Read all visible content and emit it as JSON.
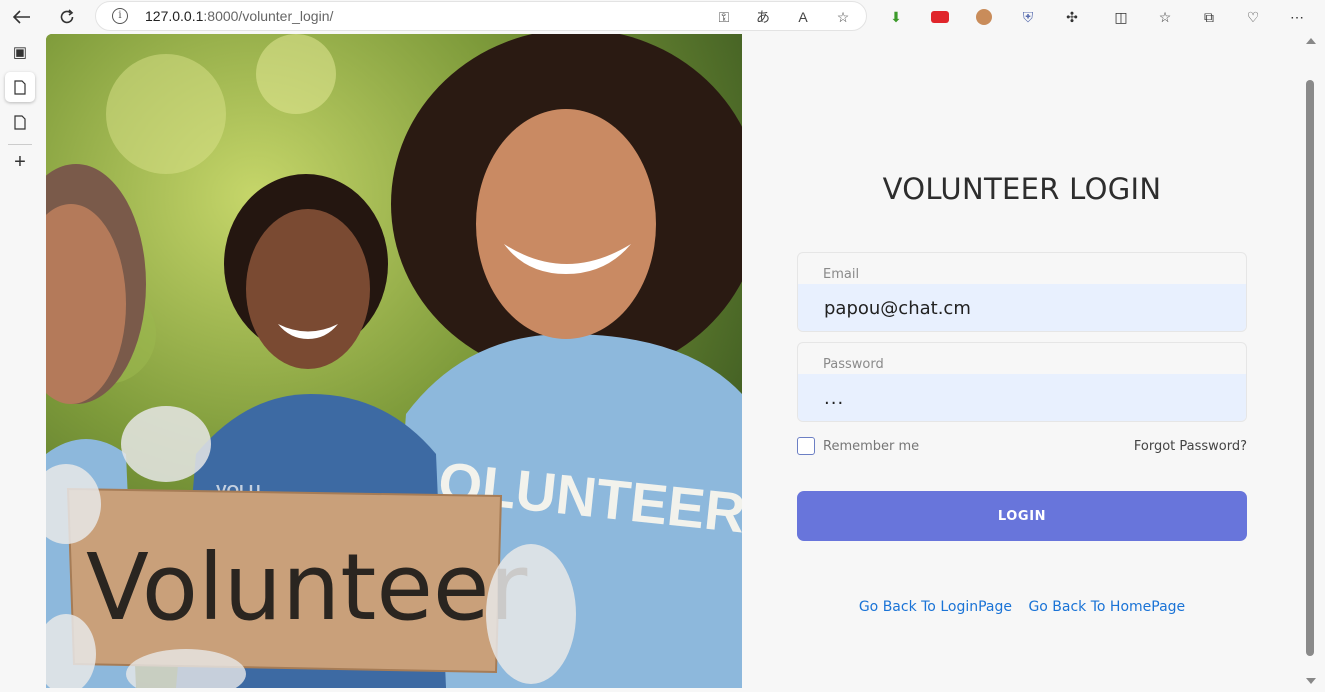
{
  "browser": {
    "url_host": "127.0.0.1",
    "url_rest": ":8000/volunter_login/"
  },
  "photo": {
    "sign_text": "Volunteer",
    "shirt_text_right": "OLUNTEER",
    "shirt_text_girl": "VOLU"
  },
  "login": {
    "title": "VOLUNTEER LOGIN",
    "email_label": "Email",
    "email_value": "papou@chat.cm",
    "password_label": "Password",
    "password_value": "...",
    "remember_label": "Remember me",
    "forgot_label": "Forgot Password?",
    "button_label": "LOGIN",
    "link_login": "Go Back To LoginPage",
    "link_home": "Go Back To HomePage"
  },
  "colors": {
    "accent": "#6875db",
    "link": "#1a73d6",
    "input_bg": "#e8f0fe"
  }
}
